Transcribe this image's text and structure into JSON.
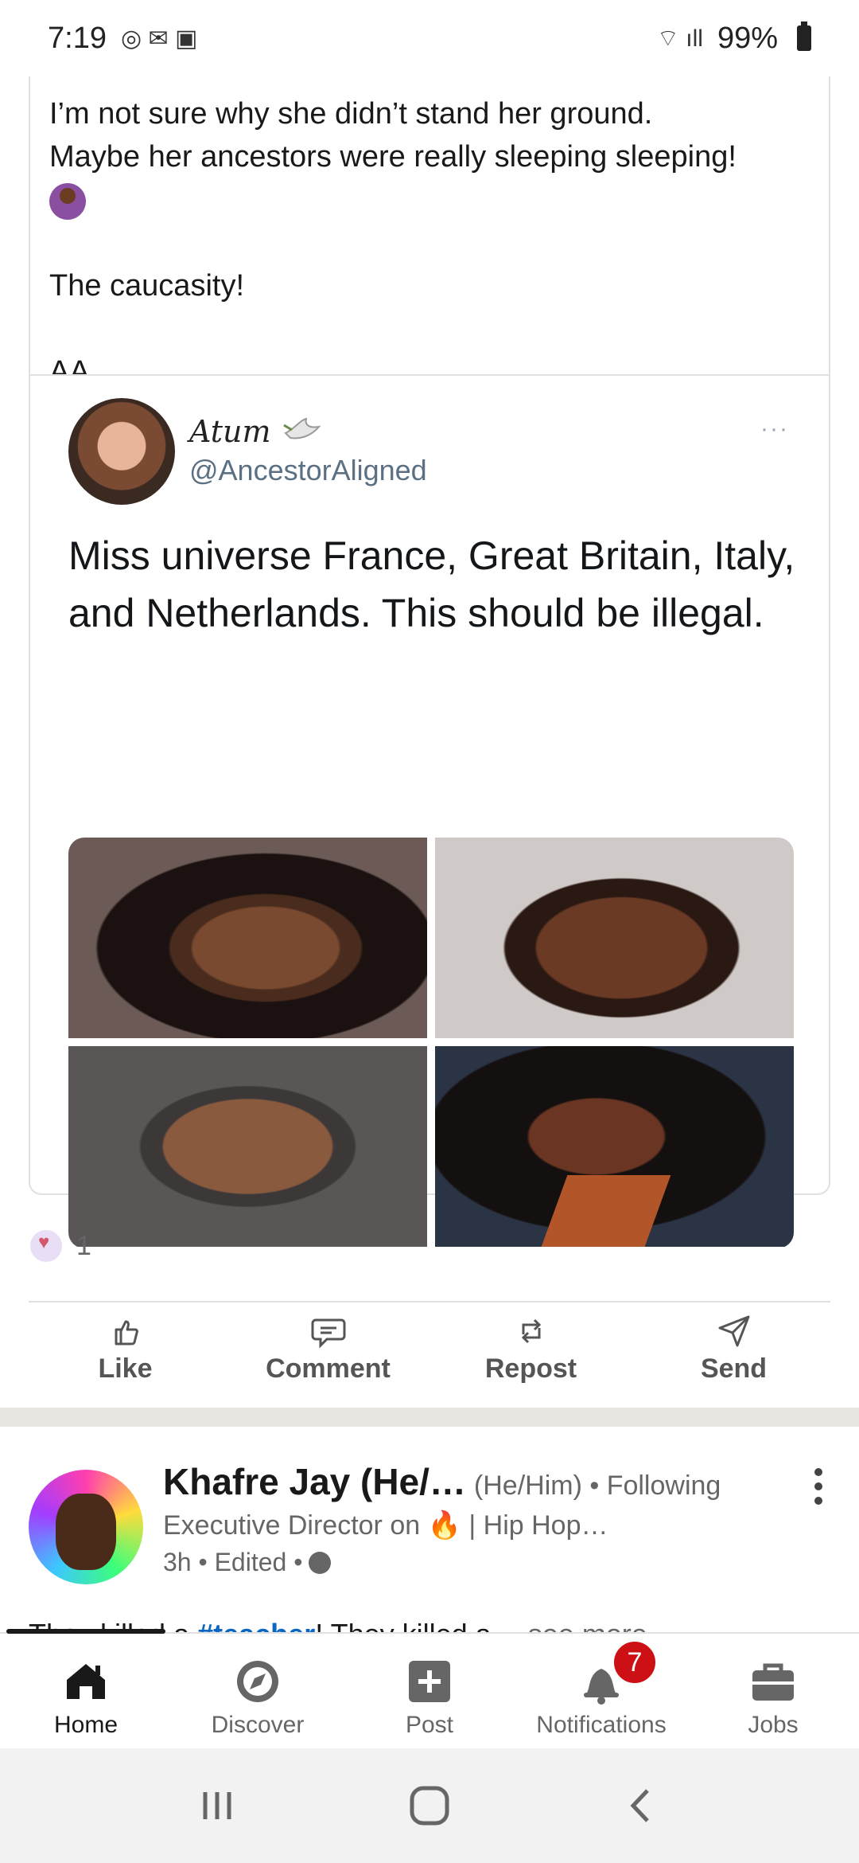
{
  "status_bar": {
    "time": "7:19",
    "battery": "99%"
  },
  "post": {
    "text_line1": "I’m not sure why she didn’t stand her ground.",
    "text_line2": "Maybe her ancestors were really sleeping sleeping!",
    "text_line3": "The caucasity!",
    "text_line4": "AA",
    "embedded_tweet": {
      "name": "Atum",
      "handle": "@AncestorAligned",
      "text": "Miss universe France, Great Britain, Italy, and Netherlands. This should be illegal.",
      "more": "···"
    },
    "reactions_count": "1"
  },
  "actions": [
    {
      "label": "Like",
      "icon": "thumbs-up-icon"
    },
    {
      "label": "Comment",
      "icon": "comment-icon"
    },
    {
      "label": "Repost",
      "icon": "repost-icon"
    },
    {
      "label": "Send",
      "icon": "send-icon"
    }
  ],
  "next_post": {
    "author": "Khafre Jay (He/…",
    "pronouns_follow": "(He/Him) • Following",
    "headline": "Executive Director on 🔥 | Hip Hop…",
    "meta": "3h • Edited •",
    "preview_start": "They killed a ",
    "preview_tag": "#teacher",
    "preview_mid": "! They killed a…",
    "see_more": "see more"
  },
  "bottom_nav": [
    {
      "label": "Home",
      "icon": "home-icon"
    },
    {
      "label": "Discover",
      "icon": "compass-icon"
    },
    {
      "label": "Post",
      "icon": "plus-square-icon"
    },
    {
      "label": "Notifications",
      "icon": "bell-icon",
      "badge": "7"
    },
    {
      "label": "Jobs",
      "icon": "briefcase-icon"
    }
  ],
  "colors": {
    "accent": "#0a66c2",
    "badge": "#cc1016",
    "text": "#191919",
    "muted": "#666666"
  }
}
